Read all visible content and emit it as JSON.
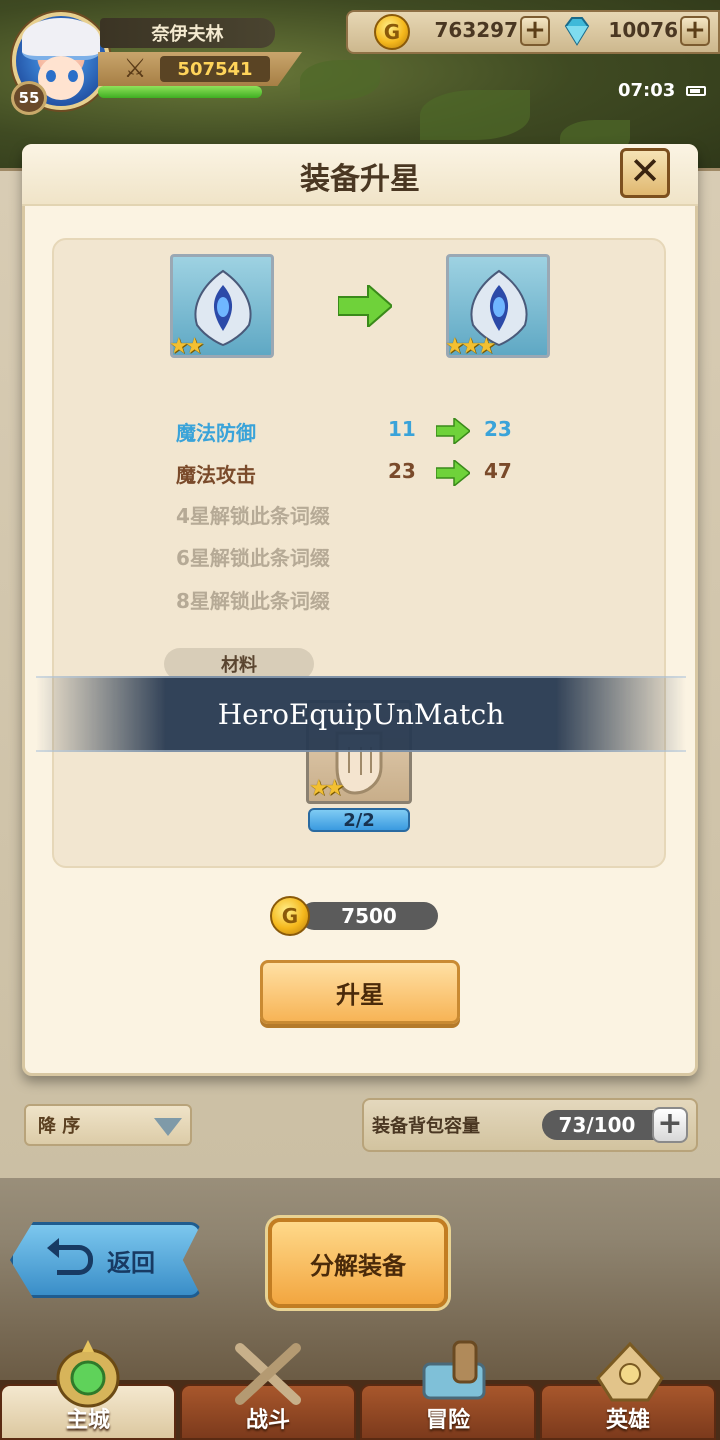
{
  "player": {
    "name": "奈伊夫林",
    "level": "55",
    "power": "507541",
    "hp_fraction": 1.0
  },
  "resources": {
    "gold": "763297",
    "gems": "10076"
  },
  "status": {
    "time": "07:03"
  },
  "modal": {
    "title": "装备升星",
    "close_icon": "close-icon",
    "from_stars": 2,
    "to_stars": 3,
    "stats": [
      {
        "name": "魔法防御",
        "from": "11",
        "to": "23",
        "color": "#3aa3d9"
      },
      {
        "name": "魔法攻击",
        "from": "23",
        "to": "47",
        "color": "#7a4a2a"
      }
    ],
    "locked_affixes": [
      "4星解锁此条词缀",
      "6星解锁此条词缀",
      "8星解锁此条词缀"
    ],
    "material_label": "材料",
    "material_count": "2/2",
    "material_stars": 2,
    "cost": "7500",
    "confirm_label": "升星"
  },
  "toast": {
    "message": "HeroEquipUnMatch"
  },
  "inventory": {
    "sort_label": "降 序",
    "capacity_label": "装备背包容量",
    "capacity_value": "73/100"
  },
  "actions": {
    "back_label": "返回",
    "decompose_label": "分解装备"
  },
  "nav": {
    "tabs": [
      "主城",
      "战斗",
      "冒险",
      "英雄"
    ],
    "active": 0
  },
  "colors": {
    "accent_gold": "#f5b81c",
    "stat_blue": "#3aa3d9",
    "stat_brown": "#7a4a2a",
    "button_orange": "#f7b456"
  }
}
